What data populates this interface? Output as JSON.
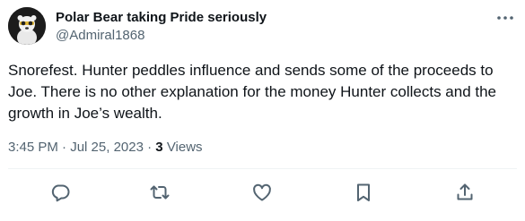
{
  "author": {
    "display_name": "Polar Bear taking Pride seriously",
    "handle": "@Admiral1868",
    "avatar_icon": "polar-bear-avatar"
  },
  "tweet": {
    "text": "Snorefest. Hunter peddles influence and sends some of the proceeds to Joe. There is no other explanation for the money Hunter collects and the growth in Joe’s wealth.",
    "time": "3:45 PM",
    "separator": "·",
    "date": "Jul 25, 2023",
    "views_count": "3",
    "views_label": "Views"
  },
  "actions": [
    {
      "icon": "reply-icon"
    },
    {
      "icon": "retweet-icon"
    },
    {
      "icon": "like-icon"
    },
    {
      "icon": "bookmark-icon"
    },
    {
      "icon": "share-icon"
    }
  ],
  "colors": {
    "text_primary": "#0f1419",
    "text_secondary": "#536471",
    "divider": "#eff3f4"
  }
}
